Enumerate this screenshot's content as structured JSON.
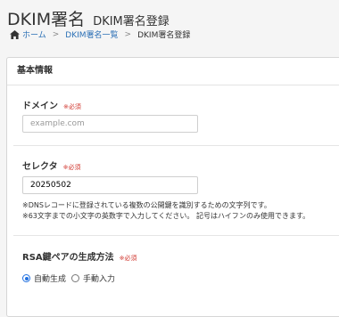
{
  "header": {
    "title": "DKIM署名",
    "subtitle": "DKIM署名登録"
  },
  "breadcrumb": {
    "home": "ホーム",
    "sep": ">",
    "list": "DKIM署名一覧",
    "current": "DKIM署名登録"
  },
  "panel": {
    "heading": "基本情報"
  },
  "domain": {
    "label": "ドメイン",
    "required": "※必須",
    "value": "",
    "placeholder": "example.com"
  },
  "selector": {
    "label": "セレクタ",
    "required": "※必須",
    "value": "20250502",
    "note1": "※DNSレコードに登録されている複数の公開鍵を識別するための文字列です。",
    "note2": "※63文字までの小文字の英数字で入力してください。 記号はハイフンのみ使用できます。"
  },
  "rsa": {
    "label": "RSA鍵ペアの生成方法",
    "required": "※必須",
    "option_auto": "自動生成",
    "option_manual": "手動入力",
    "selected": "自動生成"
  },
  "colors": {
    "link": "#2a6fb5",
    "required": "#d0342c",
    "radio_selected": "#1f6fe0"
  }
}
